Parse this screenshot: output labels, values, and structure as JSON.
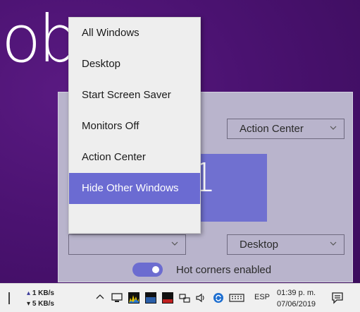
{
  "wallpaper": {
    "text": "ob"
  },
  "menu": {
    "items": [
      "All Windows",
      "Desktop",
      "Start Screen Saver",
      "Monitors Off",
      "Action Center",
      "Hide Other Windows"
    ],
    "selected_index": 5
  },
  "panel": {
    "top_right_select": "Action Center",
    "bottom_left_select": "",
    "bottom_right_select": "Desktop",
    "monitor_number": "1",
    "toggle_label": "Hot corners enabled",
    "toggle_on": true
  },
  "taskbar": {
    "net_up": "1 KB/s",
    "net_down": "5 KB/s",
    "language": "ESP",
    "time": "01:39 p. m.",
    "date": "07/06/2019"
  },
  "colors": {
    "accent": "#6b6bd2",
    "wallpaper": "#4a1270",
    "panel": "#b9b4cc"
  }
}
